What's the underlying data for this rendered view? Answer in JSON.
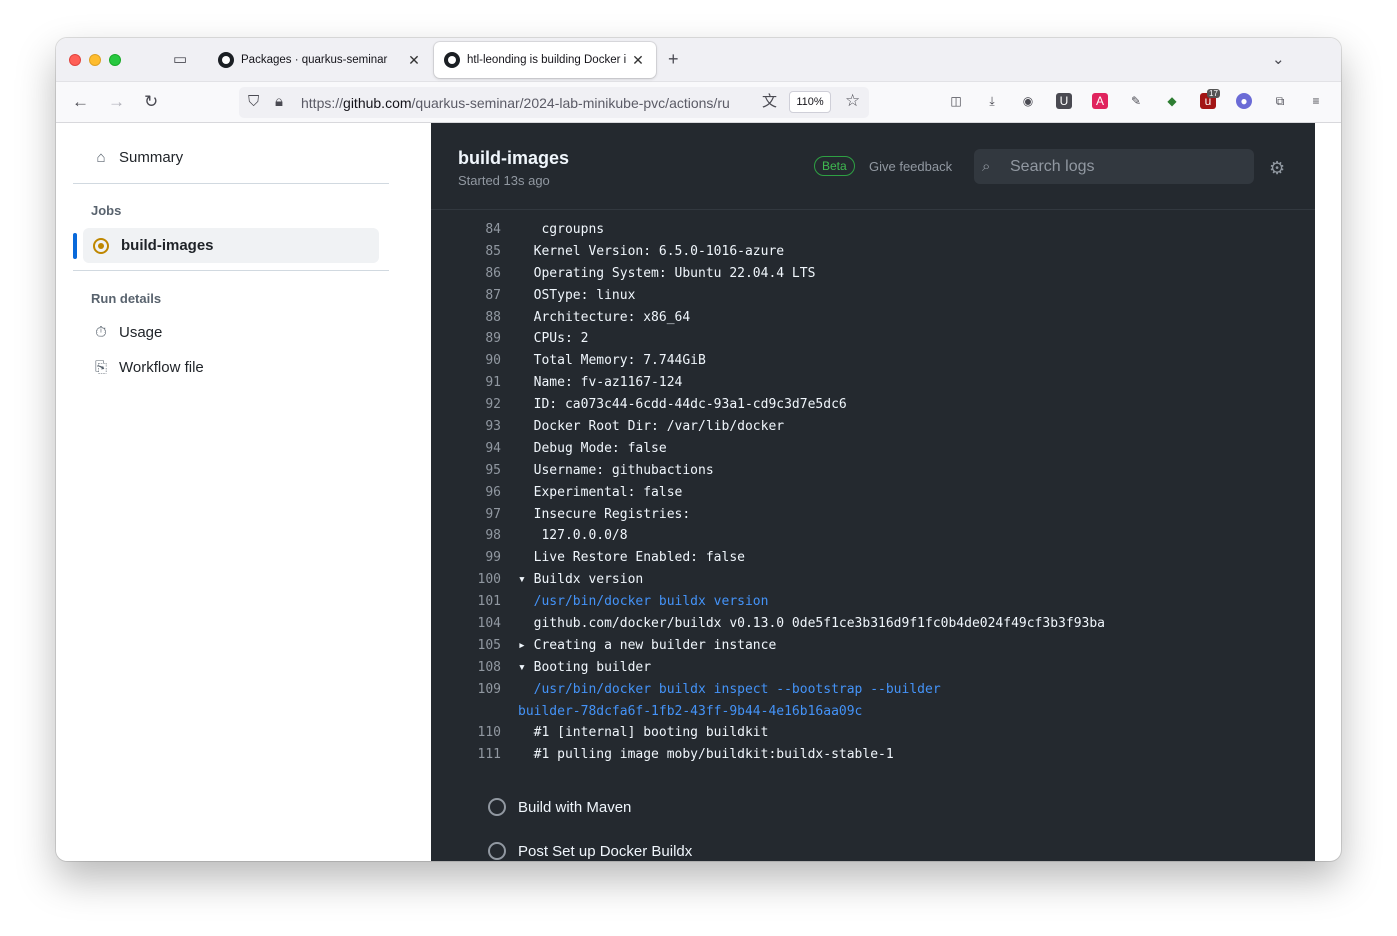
{
  "browser": {
    "tabs": [
      {
        "label": "Packages · quarkus-seminar",
        "active": false
      },
      {
        "label": "htl-leonding is building Docker i",
        "active": true
      }
    ],
    "url_prefix": "https://",
    "url_host": "github.com",
    "url_path": "/quarkus-seminar/2024-lab-minikube-pvc/actions/ru",
    "zoom": "110%",
    "badge_count": "17"
  },
  "sidebar": {
    "summary_label": "Summary",
    "jobs_heading": "Jobs",
    "job_label": "build-images",
    "run_details_heading": "Run details",
    "usage_label": "Usage",
    "workflow_file_label": "Workflow file"
  },
  "header": {
    "title": "build-images",
    "subtitle": "Started 13s ago",
    "beta": "Beta",
    "feedback": "Give feedback",
    "search_placeholder": "Search logs"
  },
  "log": {
    "lines": [
      {
        "n": "84",
        "t": "   cgroupns"
      },
      {
        "n": "85",
        "t": "  Kernel Version: 6.5.0-1016-azure"
      },
      {
        "n": "86",
        "t": "  Operating System: Ubuntu 22.04.4 LTS"
      },
      {
        "n": "87",
        "t": "  OSType: linux"
      },
      {
        "n": "88",
        "t": "  Architecture: x86_64"
      },
      {
        "n": "89",
        "t": "  CPUs: 2"
      },
      {
        "n": "90",
        "t": "  Total Memory: 7.744GiB"
      },
      {
        "n": "91",
        "t": "  Name: fv-az1167-124"
      },
      {
        "n": "92",
        "t": "  ID: ca073c44-6cdd-44dc-93a1-cd9c3d7e5dc6"
      },
      {
        "n": "93",
        "t": "  Docker Root Dir: /var/lib/docker"
      },
      {
        "n": "94",
        "t": "  Debug Mode: false"
      },
      {
        "n": "95",
        "t": "  Username: githubactions"
      },
      {
        "n": "96",
        "t": "  Experimental: false"
      },
      {
        "n": "97",
        "t": "  Insecure Registries:"
      },
      {
        "n": "98",
        "t": "   127.0.0.0/8"
      },
      {
        "n": "99",
        "t": "  Live Restore Enabled: false"
      },
      {
        "n": "100",
        "t": "▾ Buildx version"
      },
      {
        "n": "101",
        "t": "  /usr/bin/docker buildx version",
        "cmd": true
      },
      {
        "n": "104",
        "t": "  github.com/docker/buildx v0.13.0 0de5f1ce3b316d9f1fc0b4de024f49cf3b3f93ba"
      },
      {
        "n": "105",
        "t": "▸ Creating a new builder instance"
      },
      {
        "n": "108",
        "t": "▾ Booting builder"
      },
      {
        "n": "109",
        "t": "  /usr/bin/docker buildx inspect --bootstrap --builder",
        "cmd": true
      },
      {
        "n": "",
        "t": "builder-78dcfa6f-1fb2-43ff-9b44-4e16b16aa09c",
        "cmd": true
      },
      {
        "n": "110",
        "t": "  #1 [internal] booting buildkit"
      },
      {
        "n": "111",
        "t": "  #1 pulling image moby/buildkit:buildx-stable-1"
      }
    ]
  },
  "steps": [
    {
      "label": "Build with Maven"
    },
    {
      "label": "Post Set up Docker Buildx"
    }
  ]
}
